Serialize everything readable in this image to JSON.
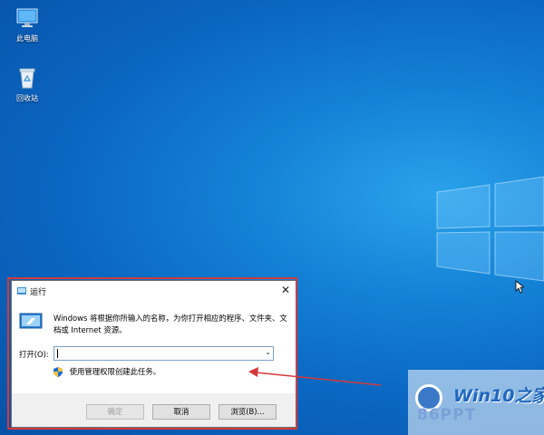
{
  "desktop": {
    "icons": [
      {
        "label": "此电脑"
      },
      {
        "label": "回收站"
      }
    ]
  },
  "run_dialog": {
    "title": "运行",
    "close_glyph": "✕",
    "description": "Windows 将根据你所输入的名称，为你打开相应的程序、文件夹、文档或 Internet 资源。",
    "open_label": "打开(O):",
    "open_value": "",
    "admin_note": "使用管理权限创建此任务。",
    "buttons": {
      "ok": "确定",
      "cancel": "取消",
      "browse": "浏览(B)..."
    }
  },
  "watermark": {
    "brand": "Win10之家",
    "sub": "86PPT"
  },
  "colors": {
    "desktop_blue": "#0b67c2",
    "annotation_red": "#d43a3a",
    "input_border": "#7a9fcf"
  },
  "icons": [
    "this-pc-icon",
    "recycle-bin-icon",
    "run-app-icon",
    "run-large-icon",
    "shield-icon",
    "chevron-down-icon",
    "close-icon",
    "mouse-cursor-icon",
    "windows-logo-icon"
  ]
}
